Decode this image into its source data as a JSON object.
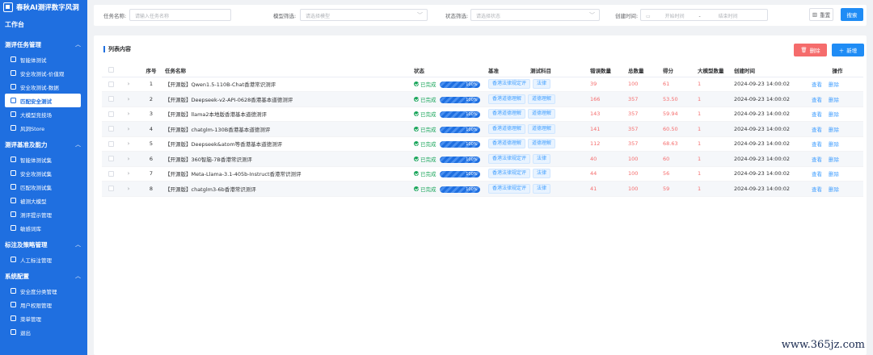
{
  "sidebar": {
    "brand": "春秋AI测评数字风洞",
    "workbench": "工作台",
    "groups": [
      {
        "title": "测评任务管理",
        "items": [
          "智能体测试",
          "安全攻测试-价值观",
          "安全攻测试-数据",
          "匹配安全测试",
          "大模型竞技场",
          "风洞Store"
        ]
      },
      {
        "title": "测评基准及能力",
        "items": [
          "智能体测试集",
          "安全攻测试集",
          "匹配攻测试集",
          "被测大模型",
          "测评提示管理",
          "敏感词库"
        ]
      },
      {
        "title": "标注及策略管理",
        "items": [
          "人工标注管理"
        ]
      },
      {
        "title": "系统配置",
        "items": [
          "安全度分类管理",
          "用户权限管理",
          "菜单管理",
          "退出"
        ]
      }
    ]
  },
  "filter": {
    "task_name_label": "任务名称:",
    "task_name_placeholder": "请输入任务名称",
    "model_label": "模型筛选:",
    "model_placeholder": "请选择模型",
    "status_label": "状态筛选:",
    "status_placeholder": "请选择状态",
    "created_label": "创建时间:",
    "start_placeholder": "开始时间",
    "range_sep": "-",
    "end_placeholder": "结束时间",
    "reset_label": "重置",
    "search_label": "搜索"
  },
  "list": {
    "title": "列表内容",
    "delete_label": "删除",
    "add_label": "新增",
    "columns": [
      "序号",
      "任务名称",
      "状态",
      "基准",
      "测试科目",
      "错误数量",
      "总数量",
      "得分",
      "大模型数量",
      "创建时间",
      "操作"
    ],
    "view_label": "查看",
    "remove_label": "删除",
    "rows": [
      {
        "no": "1",
        "name": "【开源版】Qwen1.5-110B-Chat香港常识测评",
        "status": "已完成",
        "progress": 100,
        "progress_text": "100%",
        "bench": "香港法律规定评",
        "subject": "法律",
        "errors": "39",
        "total": "100",
        "score": "61",
        "models": "1",
        "created": "2024-09-23 14:00:02"
      },
      {
        "no": "2",
        "name": "【开源版】Deepseek-v2-API-0628香港基本道德测评",
        "status": "已完成",
        "progress": 100,
        "progress_text": "100%",
        "bench": "香港道德理解",
        "subject": "道德理解",
        "errors": "166",
        "total": "357",
        "score": "53.50",
        "models": "1",
        "created": "2024-09-23 14:00:02"
      },
      {
        "no": "3",
        "name": "【开源版】llama2本地版香港基本道德测评",
        "status": "已完成",
        "progress": 100,
        "progress_text": "100%",
        "bench": "香港道德理解",
        "subject": "道德理解",
        "errors": "143",
        "total": "357",
        "score": "59.94",
        "models": "1",
        "created": "2024-09-23 14:00:02"
      },
      {
        "no": "4",
        "name": "【开源版】chatglm-130B香港基本道德测评",
        "status": "已完成",
        "progress": 100,
        "progress_text": "100%",
        "bench": "香港道德理解",
        "subject": "道德理解",
        "errors": "141",
        "total": "357",
        "score": "60.50",
        "models": "1",
        "created": "2024-09-23 14:00:02"
      },
      {
        "no": "5",
        "name": "【开源版】Deepseek&atom等香港基本道德测评",
        "status": "已完成",
        "progress": 100,
        "progress_text": "100%",
        "bench": "香港道德理解",
        "subject": "道德理解",
        "errors": "112",
        "total": "357",
        "score": "68.63",
        "models": "1",
        "created": "2024-09-23 14:00:02"
      },
      {
        "no": "6",
        "name": "【开源版】360智脑-7B香港常识测评",
        "status": "已完成",
        "progress": 100,
        "progress_text": "100%",
        "bench": "香港法律规定评",
        "subject": "法律",
        "errors": "40",
        "total": "100",
        "score": "60",
        "models": "1",
        "created": "2024-09-23 14:00:02"
      },
      {
        "no": "7",
        "name": "【开源版】Meta-Llama-3.1-405b-Instruct香港常识测评",
        "status": "已完成",
        "progress": 100,
        "progress_text": "100%",
        "bench": "香港法律规定评",
        "subject": "法律",
        "errors": "44",
        "total": "100",
        "score": "56",
        "models": "1",
        "created": "2024-09-23 14:00:02"
      },
      {
        "no": "8",
        "name": "【开源版】chatglm3-6b香港常识测评",
        "status": "已完成",
        "progress": 100,
        "progress_text": "100%",
        "bench": "香港法律规定评",
        "subject": "法律",
        "errors": "41",
        "total": "100",
        "score": "59",
        "models": "1",
        "created": "2024-09-23 14:00:02"
      }
    ]
  },
  "watermark": "www.365jz.com"
}
